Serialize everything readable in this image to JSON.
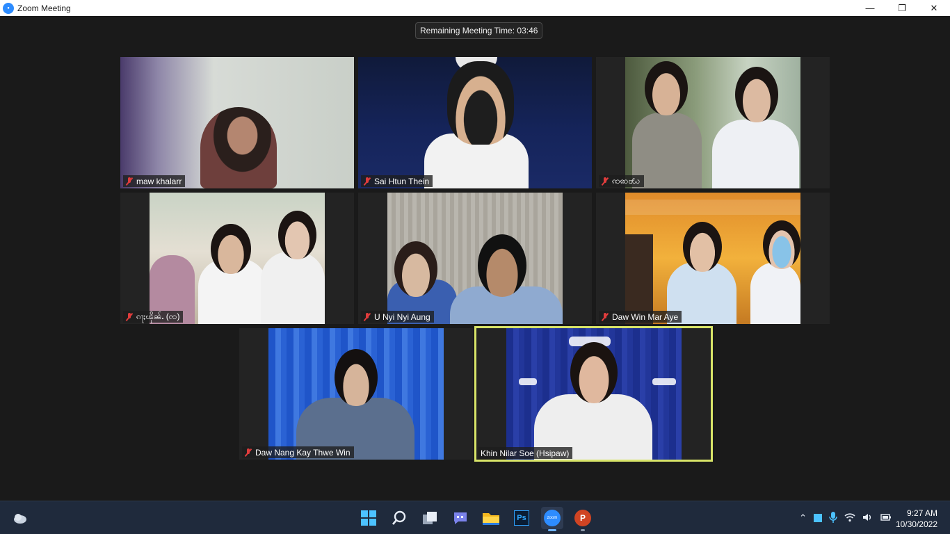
{
  "window": {
    "title": "Zoom Meeting",
    "minimize": "—",
    "restore": "❐",
    "close": "✕"
  },
  "meeting": {
    "remaining_time": "Remaining Meeting Time: 03:46"
  },
  "participants": [
    {
      "name": "maw khalarr",
      "muted": true
    },
    {
      "name": "Sai Htun Thein",
      "muted": true
    },
    {
      "name": "ꩡꩣ꩸ꩬ",
      "muted": true
    },
    {
      "name": "ၵႃႈၽိုၼ်ႉ (ၸ)",
      "muted": true
    },
    {
      "name": "U Nyi Nyi Aung",
      "muted": true
    },
    {
      "name": "Daw Win Mar Aye",
      "muted": true
    },
    {
      "name": "Daw Nang Kay Thwe Win",
      "muted": true
    },
    {
      "name": "Khin Nilar Soe (Hsipaw)",
      "muted": false
    }
  ],
  "taskbar": {
    "apps": [
      {
        "name": "start-icon"
      },
      {
        "name": "search-icon"
      },
      {
        "name": "task-view-icon"
      },
      {
        "name": "chat-icon"
      },
      {
        "name": "file-explorer-icon"
      },
      {
        "name": "photoshop-icon",
        "label": "Ps"
      },
      {
        "name": "zoom-icon",
        "label": "zoom"
      },
      {
        "name": "powerpoint-icon",
        "label": "P"
      }
    ],
    "time": "9:27 AM",
    "date": "10/30/2022"
  },
  "colors": {
    "active_speaker_border": "#d8e468",
    "muted_mic": "#e03c3c",
    "zoom_blue": "#2d8cff"
  }
}
